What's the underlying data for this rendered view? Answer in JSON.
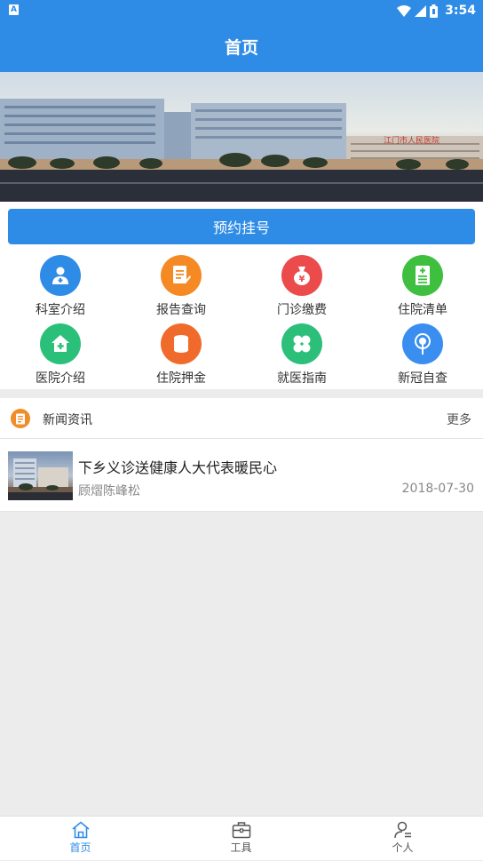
{
  "status_bar": {
    "time": "3:54"
  },
  "app_bar": {
    "title": "首页"
  },
  "banner": {
    "sign_text": "江门市人民医院"
  },
  "booking": {
    "label": "预约挂号"
  },
  "grid": [
    {
      "label": "科室介绍",
      "icon": "doctor-icon",
      "color": "#2f8ce6"
    },
    {
      "label": "报告查询",
      "icon": "report-icon",
      "color": "#f58a24"
    },
    {
      "label": "门诊缴费",
      "icon": "money-bag-icon",
      "color": "#ec4b4b"
    },
    {
      "label": "住院清单",
      "icon": "list-icon",
      "color": "#3fbf3f"
    },
    {
      "label": "医院介绍",
      "icon": "hospital-icon",
      "color": "#2bc07a"
    },
    {
      "label": "住院押金",
      "icon": "coins-icon",
      "color": "#f06a2c"
    },
    {
      "label": "就医指南",
      "icon": "clover-icon",
      "color": "#2bbf7a"
    },
    {
      "label": "新冠自查",
      "icon": "virus-check-icon",
      "color": "#3a8ef0"
    }
  ],
  "news": {
    "header_title": "新闻资讯",
    "more_label": "更多",
    "items": [
      {
        "title": "下乡义诊送健康人大代表暖民心",
        "author": "顾熠陈峰松",
        "date": "2018-07-30"
      }
    ]
  },
  "bottom_nav": [
    {
      "label": "首页",
      "icon": "home-icon",
      "active": true
    },
    {
      "label": "工具",
      "icon": "toolbox-icon",
      "active": false
    },
    {
      "label": "个人",
      "icon": "person-icon",
      "active": false
    }
  ],
  "colors": {
    "primary": "#2f8ce6",
    "background": "#ececec"
  }
}
